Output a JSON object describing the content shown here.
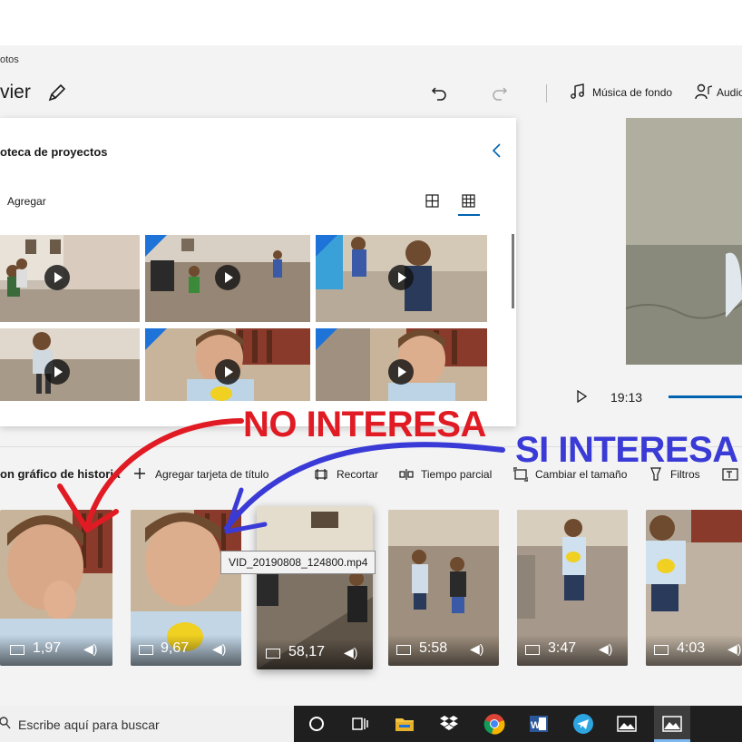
{
  "app": {
    "title": "otos",
    "project_name": "vier"
  },
  "toolbar": {
    "music_label": "Música de fondo",
    "audio_label": "Audio"
  },
  "library": {
    "title": "oteca de proyectos",
    "add_label": "Agregar"
  },
  "preview": {
    "time": "19:13"
  },
  "storyboard": {
    "title": "on gráfico de historia",
    "actions": [
      {
        "label": "Agregar tarjeta de título",
        "icon": "plus-icon"
      },
      {
        "label": "Recortar",
        "icon": "trim-icon"
      },
      {
        "label": "Tiempo parcial",
        "icon": "split-icon"
      },
      {
        "label": "Cambiar el tamaño",
        "icon": "resize-icon"
      },
      {
        "label": "Filtros",
        "icon": "filter-icon"
      },
      {
        "label": "",
        "icon": "text-icon"
      }
    ],
    "clips": [
      {
        "duration": "1,97"
      },
      {
        "duration": "9,67"
      },
      {
        "duration": "58,17"
      },
      {
        "duration": "5:58"
      },
      {
        "duration": "3:47"
      },
      {
        "duration": "4:03"
      }
    ],
    "tooltip": "VID_20190808_124800.mp4"
  },
  "annotations": {
    "no_interesa": "NO INTERESA",
    "si_interesa": "SI INTERESA",
    "no_color": "#e01b24",
    "si_color": "#3a3ad6"
  },
  "taskbar": {
    "search_placeholder": "Escribe aquí para buscar",
    "apps": [
      "cortana-icon",
      "task-view-icon",
      "file-explorer-icon",
      "dropbox-icon",
      "chrome-icon",
      "word-icon",
      "telegram-icon",
      "photos-icon",
      "photos-active-icon"
    ]
  }
}
